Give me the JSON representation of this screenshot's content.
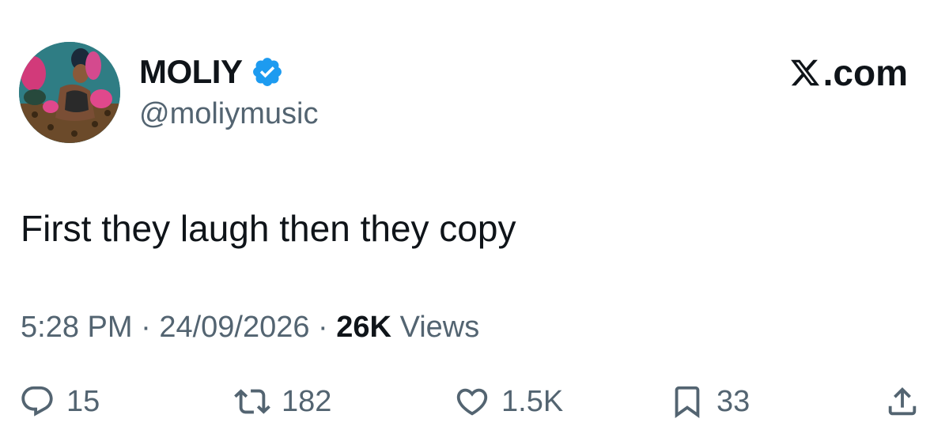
{
  "user": {
    "display_name": "MOLIY",
    "handle": "@moliymusic",
    "verified": true,
    "avatar_icon": "profile-photo"
  },
  "site": {
    "label": ".com",
    "logo_icon": "x-logo-icon"
  },
  "tweet": {
    "text": "First they laugh then they copy",
    "time": "5:28 PM",
    "date": "24/09/2026",
    "views_count": "26K",
    "views_label": "Views",
    "separator": " · "
  },
  "actions": {
    "reply": {
      "icon": "reply-icon",
      "count": "15"
    },
    "retweet": {
      "icon": "retweet-icon",
      "count": "182"
    },
    "like": {
      "icon": "heart-icon",
      "count": "1.5K"
    },
    "bookmark": {
      "icon": "bookmark-icon",
      "count": "33"
    },
    "share": {
      "icon": "share-icon"
    }
  },
  "colors": {
    "text_primary": "#0f1419",
    "text_secondary": "#536471",
    "verified_blue": "#1d9bf0",
    "icon_gray": "#536471"
  }
}
